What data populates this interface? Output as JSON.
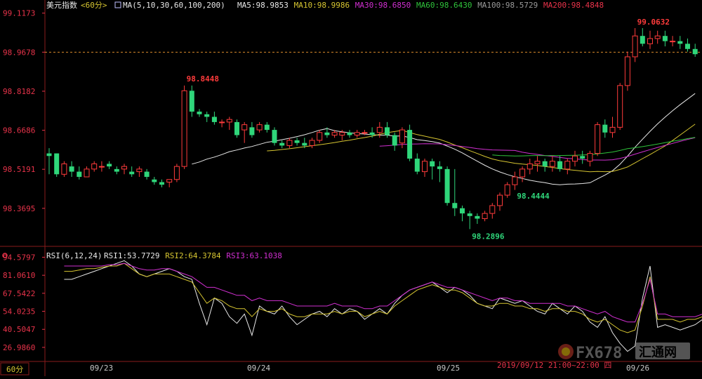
{
  "header": {
    "index_name": "美元指数",
    "period": "<60分>",
    "ma_params": "MA(5,10,30,60,100,200)",
    "ma_values": [
      {
        "label": "MA5:98.9853",
        "color": "#e8e8e8"
      },
      {
        "label": "MA10:98.9986",
        "color": "#d6c531"
      },
      {
        "label": "MA30:98.6850",
        "color": "#d12fd1"
      },
      {
        "label": "MA60:98.6430",
        "color": "#2fc43b"
      },
      {
        "label": "MA100:98.5729",
        "color": "#9a9a9a"
      },
      {
        "label": "MA200:98.4848",
        "color": "#e8334a"
      }
    ]
  },
  "rsi_header": {
    "params": "RSI(6,12,24)",
    "values": [
      {
        "label": "RSI1:53.7729",
        "color": "#e8e8e8"
      },
      {
        "label": "RSI2:64.3784",
        "color": "#d6c531"
      },
      {
        "label": "RSI3:63.1038",
        "color": "#d12fd1"
      }
    ]
  },
  "footer": {
    "period_button": "60分",
    "dates": [
      "09/23",
      "09/24",
      "09/25",
      "09/26"
    ],
    "hover_time": "2019/09/12 21:00~22:00 四"
  },
  "watermark": {
    "text1": "FX678",
    "text2": "汇通网"
  },
  "chart_data": [
    {
      "type": "candlestick",
      "title": "",
      "y_ticks": [
        "99.1173",
        "98.9678",
        "98.8182",
        "98.6686",
        "98.5191",
        "98.3695"
      ],
      "ylim": [
        98.24,
        99.13
      ],
      "current_price_line": 98.9678,
      "annotations": [
        {
          "label": "98.8448",
          "value": 98.8448,
          "kind": "high"
        },
        {
          "label": "98.4444",
          "value": 98.4444,
          "kind": "low"
        },
        {
          "label": "98.2896",
          "value": 98.2896,
          "kind": "low"
        },
        {
          "label": "99.0632",
          "value": 99.0632,
          "kind": "high"
        }
      ],
      "candles": [
        [
          98.58,
          98.6,
          98.5,
          98.57
        ],
        [
          98.58,
          98.58,
          98.49,
          98.5
        ],
        [
          98.5,
          98.55,
          98.49,
          98.54
        ],
        [
          98.53,
          98.55,
          98.49,
          98.51
        ],
        [
          98.51,
          98.53,
          98.48,
          98.49
        ],
        [
          98.49,
          98.53,
          98.49,
          98.52
        ],
        [
          98.52,
          98.55,
          98.51,
          98.54
        ],
        [
          98.53,
          98.55,
          98.51,
          98.53
        ],
        [
          98.54,
          98.55,
          98.52,
          98.53
        ],
        [
          98.52,
          98.53,
          98.5,
          98.51
        ],
        [
          98.52,
          98.54,
          98.5,
          98.53
        ],
        [
          98.51,
          98.53,
          98.49,
          98.5
        ],
        [
          98.51,
          98.53,
          98.49,
          98.52
        ],
        [
          98.51,
          98.52,
          98.48,
          98.49
        ],
        [
          98.48,
          98.49,
          98.46,
          98.47
        ],
        [
          98.47,
          98.48,
          98.45,
          98.46
        ],
        [
          98.47,
          98.48,
          98.45,
          98.48
        ],
        [
          98.48,
          98.54,
          98.47,
          98.53
        ],
        [
          98.53,
          98.84,
          98.52,
          98.82
        ],
        [
          98.82,
          98.84,
          98.72,
          98.74
        ],
        [
          98.74,
          98.75,
          98.72,
          98.73
        ],
        [
          98.73,
          98.74,
          98.7,
          98.72
        ],
        [
          98.72,
          98.74,
          98.69,
          98.7
        ],
        [
          98.7,
          98.71,
          98.68,
          98.7
        ],
        [
          98.7,
          98.72,
          98.67,
          98.71
        ],
        [
          98.7,
          98.71,
          98.64,
          98.65
        ],
        [
          98.67,
          98.7,
          98.62,
          98.69
        ],
        [
          98.68,
          98.7,
          98.64,
          98.65
        ],
        [
          98.67,
          98.7,
          98.66,
          98.69
        ],
        [
          98.69,
          98.7,
          98.66,
          98.67
        ],
        [
          98.67,
          98.68,
          98.61,
          98.62
        ],
        [
          98.62,
          98.63,
          98.6,
          98.61
        ],
        [
          98.61,
          98.64,
          98.6,
          98.63
        ],
        [
          98.63,
          98.64,
          98.61,
          98.62
        ],
        [
          98.62,
          98.64,
          98.6,
          98.61
        ],
        [
          98.61,
          98.64,
          98.6,
          98.63
        ],
        [
          98.63,
          98.67,
          98.62,
          98.66
        ],
        [
          98.66,
          98.68,
          98.64,
          98.65
        ],
        [
          98.65,
          98.67,
          98.64,
          98.66
        ],
        [
          98.65,
          98.67,
          98.63,
          98.66
        ],
        [
          98.66,
          98.67,
          98.64,
          98.65
        ],
        [
          98.65,
          98.67,
          98.64,
          98.66
        ],
        [
          98.66,
          98.67,
          98.65,
          98.66
        ],
        [
          98.66,
          98.68,
          98.64,
          98.65
        ],
        [
          98.66,
          98.7,
          98.64,
          98.68
        ],
        [
          98.68,
          98.7,
          98.64,
          98.65
        ],
        [
          98.65,
          98.66,
          98.59,
          98.61
        ],
        [
          98.62,
          98.68,
          98.6,
          98.67
        ],
        [
          98.67,
          98.69,
          98.55,
          98.56
        ],
        [
          98.56,
          98.58,
          98.5,
          98.51
        ],
        [
          98.51,
          98.56,
          98.49,
          98.55
        ],
        [
          98.55,
          98.56,
          98.48,
          98.53
        ],
        [
          98.53,
          98.55,
          98.47,
          98.52
        ],
        [
          98.52,
          98.53,
          98.38,
          98.39
        ],
        [
          98.39,
          98.52,
          98.34,
          98.37
        ],
        [
          98.37,
          98.38,
          98.32,
          98.35
        ],
        [
          98.35,
          98.36,
          98.29,
          98.34
        ],
        [
          98.34,
          98.35,
          98.31,
          98.33
        ],
        [
          98.33,
          98.36,
          98.32,
          98.35
        ],
        [
          98.35,
          98.39,
          98.33,
          98.38
        ],
        [
          98.38,
          98.43,
          98.36,
          98.42
        ],
        [
          98.42,
          98.47,
          98.41,
          98.46
        ],
        [
          98.46,
          98.51,
          98.44,
          98.49
        ],
        [
          98.49,
          98.53,
          98.47,
          98.52
        ],
        [
          98.52,
          98.56,
          98.5,
          98.54
        ],
        [
          98.54,
          98.57,
          98.51,
          98.55
        ],
        [
          98.55,
          98.56,
          98.51,
          98.53
        ],
        [
          98.53,
          98.57,
          98.51,
          98.55
        ],
        [
          98.55,
          98.57,
          98.51,
          98.52
        ],
        [
          98.52,
          98.56,
          98.5,
          98.55
        ],
        [
          98.55,
          98.59,
          98.53,
          98.57
        ],
        [
          98.57,
          98.59,
          98.54,
          98.56
        ],
        [
          98.55,
          98.59,
          98.53,
          98.58
        ],
        [
          98.58,
          98.7,
          98.57,
          98.69
        ],
        [
          98.69,
          98.71,
          98.64,
          98.66
        ],
        [
          98.66,
          98.72,
          98.64,
          98.68
        ],
        [
          98.68,
          98.85,
          98.67,
          98.84
        ],
        [
          98.84,
          98.97,
          98.82,
          98.95
        ],
        [
          98.95,
          99.06,
          98.93,
          99.03
        ],
        [
          99.03,
          99.06,
          98.99,
          99.0
        ],
        [
          99.0,
          99.05,
          98.98,
          99.02
        ],
        [
          99.02,
          99.05,
          99.0,
          99.03
        ],
        [
          99.03,
          99.05,
          98.99,
          99.01
        ],
        [
          99.01,
          99.03,
          98.99,
          99.01
        ],
        [
          99.01,
          99.03,
          98.98,
          99.0
        ],
        [
          99.0,
          99.02,
          98.97,
          98.98
        ],
        [
          98.98,
          99.0,
          98.95,
          98.96
        ]
      ]
    },
    {
      "type": "line",
      "title": "",
      "y_ticks": [
        "94.5797",
        "81.0610",
        "67.5422",
        "54.0235",
        "40.5047",
        "26.9860"
      ],
      "ylim": [
        18,
        98
      ],
      "series": [
        {
          "name": "RSI1",
          "color": "#e8e8e8",
          "values": [
            78,
            78,
            80,
            82,
            84,
            86,
            88,
            90,
            92,
            88,
            82,
            80,
            82,
            84,
            86,
            84,
            80,
            78,
            60,
            44,
            64,
            60,
            50,
            45,
            52,
            36,
            58,
            54,
            52,
            58,
            50,
            44,
            48,
            52,
            54,
            50,
            56,
            52,
            56,
            54,
            48,
            52,
            56,
            52,
            60,
            66,
            70,
            72,
            74,
            76,
            72,
            68,
            72,
            70,
            66,
            60,
            58,
            56,
            64,
            62,
            60,
            62,
            58,
            54,
            52,
            60,
            56,
            52,
            58,
            54,
            46,
            42,
            50,
            38,
            30,
            24,
            28,
            64,
            88,
            42,
            44,
            42,
            40,
            42,
            44,
            48,
            50
          ]
        },
        {
          "name": "RSI2",
          "color": "#d6c531",
          "values": [
            84,
            84,
            85,
            86,
            86,
            87,
            88,
            88,
            90,
            86,
            82,
            80,
            82,
            82,
            82,
            80,
            78,
            76,
            68,
            60,
            64,
            62,
            58,
            56,
            56,
            50,
            56,
            54,
            54,
            56,
            52,
            50,
            50,
            52,
            52,
            52,
            54,
            52,
            54,
            54,
            50,
            52,
            54,
            52,
            58,
            62,
            66,
            70,
            72,
            74,
            72,
            70,
            70,
            68,
            64,
            60,
            58,
            58,
            60,
            60,
            58,
            58,
            56,
            56,
            54,
            56,
            56,
            54,
            54,
            52,
            48,
            46,
            48,
            44,
            40,
            38,
            40,
            58,
            80,
            48,
            48,
            48,
            46,
            48,
            48,
            50,
            52
          ]
        },
        {
          "name": "RSI3",
          "color": "#d12fd1",
          "values": [
            88,
            88,
            88,
            88,
            88,
            88,
            89,
            89,
            90,
            88,
            86,
            85,
            85,
            86,
            86,
            84,
            82,
            80,
            76,
            72,
            72,
            70,
            68,
            66,
            66,
            62,
            64,
            62,
            62,
            62,
            60,
            58,
            58,
            58,
            58,
            58,
            60,
            58,
            58,
            58,
            56,
            56,
            58,
            58,
            62,
            66,
            70,
            72,
            74,
            76,
            74,
            72,
            72,
            70,
            68,
            66,
            64,
            62,
            64,
            64,
            62,
            62,
            60,
            60,
            60,
            60,
            60,
            58,
            58,
            56,
            54,
            52,
            54,
            50,
            48,
            46,
            46,
            60,
            78,
            52,
            52,
            50,
            50,
            50,
            50,
            52,
            54
          ]
        }
      ]
    }
  ]
}
